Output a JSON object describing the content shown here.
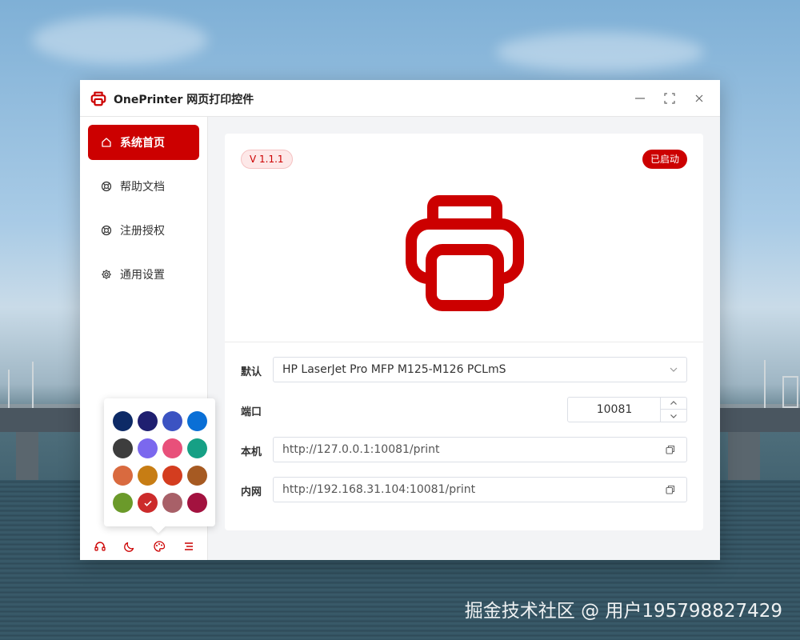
{
  "window": {
    "title": "OnePrinter 网页打印控件"
  },
  "sidebar": {
    "items": [
      {
        "label": "系统首页",
        "icon": "home-icon",
        "active": true
      },
      {
        "label": "帮助文档",
        "icon": "lifebuoy-icon",
        "active": false
      },
      {
        "label": "注册授权",
        "icon": "lifebuoy-icon",
        "active": false
      },
      {
        "label": "通用设置",
        "icon": "gear-icon",
        "active": false
      }
    ],
    "bottom_icons": [
      "headset-icon",
      "moon-icon",
      "palette-icon",
      "menu-icon"
    ]
  },
  "theme_palette": {
    "colors": [
      "#0d2a66",
      "#1f1f70",
      "#3b53c2",
      "#0a6fd6",
      "#3d3d3d",
      "#7b68ee",
      "#e8507a",
      "#16a085",
      "#d96a3f",
      "#c77d14",
      "#d43d1f",
      "#a65a22",
      "#6b9a2a",
      "#cc2b2b",
      "#a86068",
      "#a3123f"
    ],
    "selected_index": 13
  },
  "main": {
    "version": "V 1.1.1",
    "status": "已启动",
    "accent_color": "#cc0000",
    "printer_label": "默认",
    "printer_value": "HP LaserJet Pro MFP M125-M126 PCLmS",
    "port_label": "端口",
    "port_value": "10081",
    "local_label": "本机",
    "local_url": "http://127.0.0.1:10081/print",
    "lan_label": "内网",
    "lan_url": "http://192.168.31.104:10081/print"
  },
  "watermark": "掘金技术社区 @ 用户195798827429"
}
